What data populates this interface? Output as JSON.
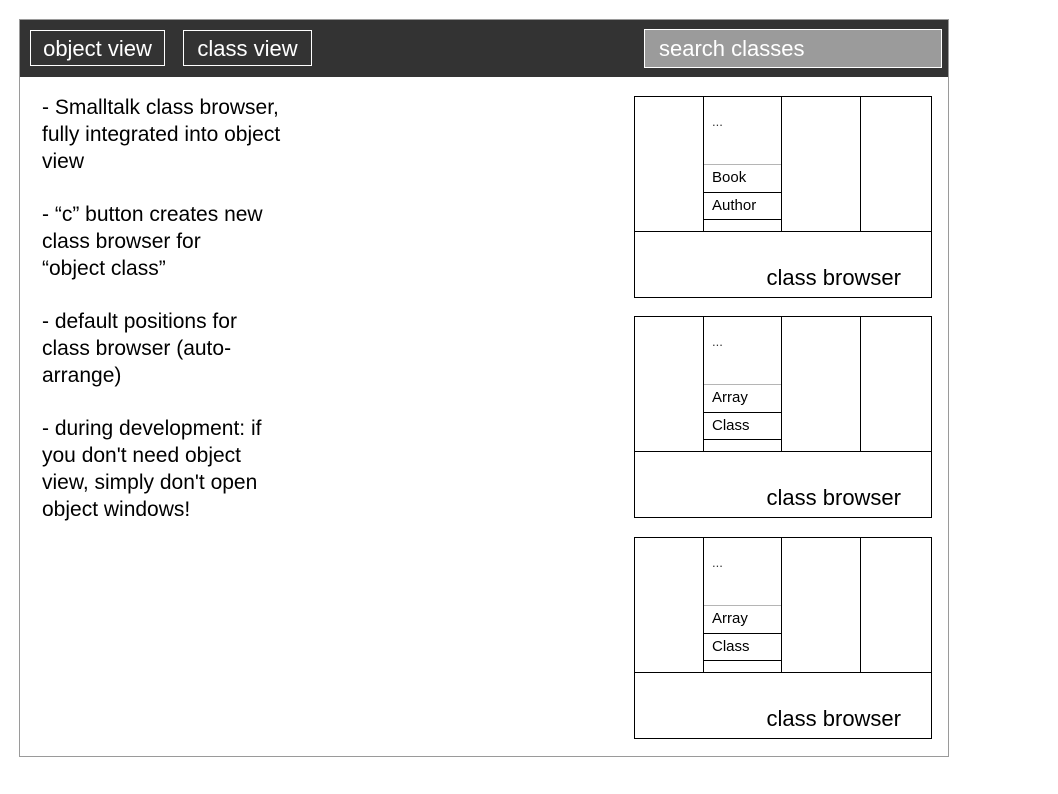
{
  "toolbar": {
    "tabs": [
      "object view",
      "class view"
    ],
    "search_placeholder": "search classes"
  },
  "notes": [
    "- Smalltalk class browser,\nfully integrated into object\nview",
    "- “c” button creates new\nclass browser for\n“object class”",
    "- default positions for\nclass browser (auto-\narrange)",
    "- during development: if\nyou don't need object\nview, simply don't open\nobject windows!"
  ],
  "browsers": [
    {
      "ellipsis": "...",
      "classes": [
        "Book",
        "Author"
      ],
      "label": "class browser"
    },
    {
      "ellipsis": "...",
      "classes": [
        "Array",
        "Class"
      ],
      "label": "class browser"
    },
    {
      "ellipsis": "...",
      "classes": [
        "Array",
        "Class"
      ],
      "label": "class browser"
    }
  ]
}
